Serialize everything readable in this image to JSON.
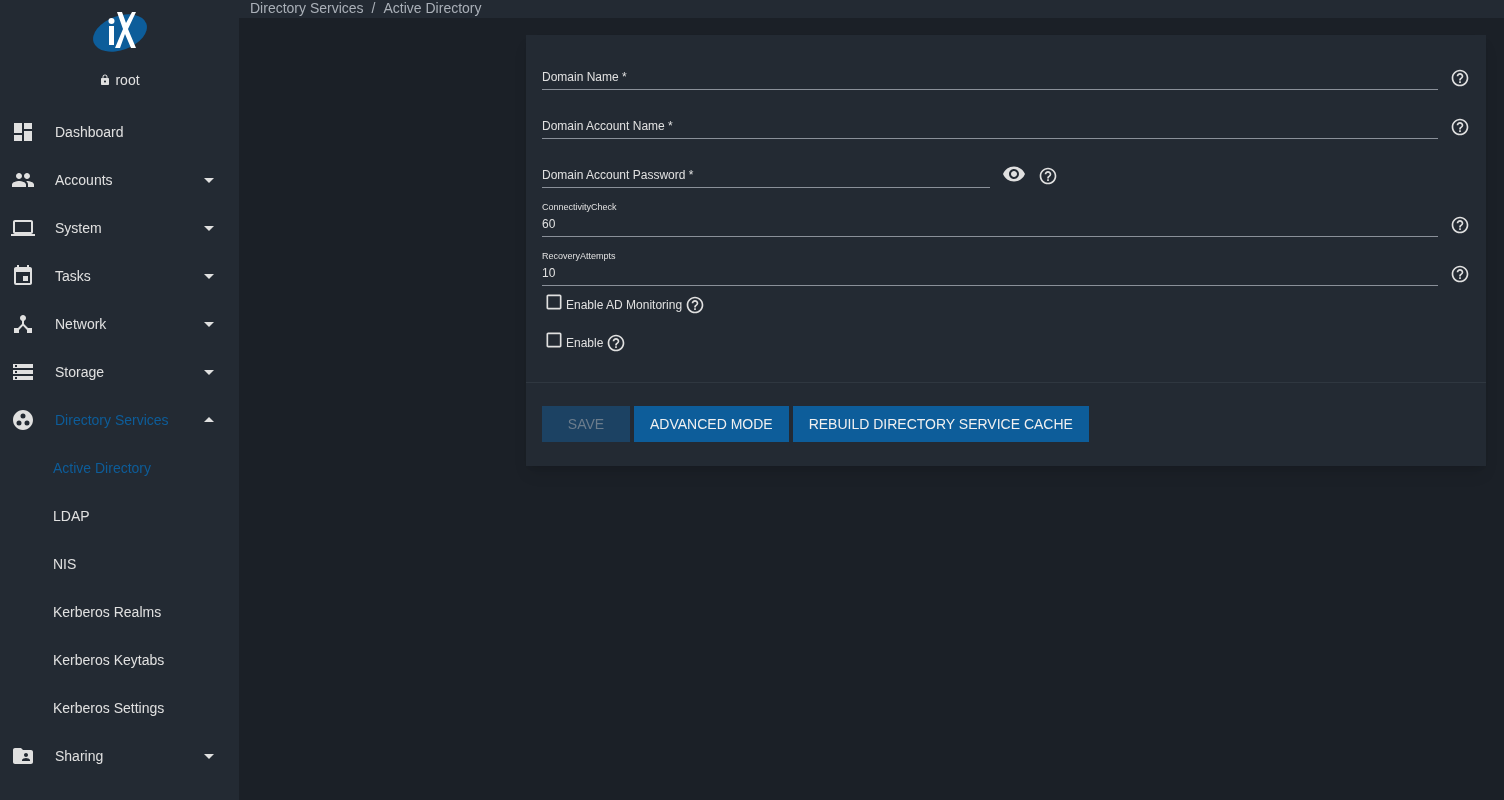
{
  "user": "root",
  "breadcrumb": {
    "items": [
      "Directory Services",
      "Active Directory"
    ],
    "separator": "/"
  },
  "nav": [
    {
      "label": "Dashboard",
      "kind": "link"
    },
    {
      "label": "Accounts",
      "kind": "group",
      "expanded": false
    },
    {
      "label": "System",
      "kind": "group",
      "expanded": false
    },
    {
      "label": "Tasks",
      "kind": "group",
      "expanded": false
    },
    {
      "label": "Network",
      "kind": "group",
      "expanded": false
    },
    {
      "label": "Storage",
      "kind": "group",
      "expanded": false
    },
    {
      "label": "Directory Services",
      "kind": "group",
      "expanded": true,
      "selected": true,
      "children": [
        {
          "label": "Active Directory",
          "selected": true
        },
        {
          "label": "LDAP",
          "selected": false
        },
        {
          "label": "NIS",
          "selected": false
        },
        {
          "label": "Kerberos Realms",
          "selected": false
        },
        {
          "label": "Kerberos Keytabs",
          "selected": false
        },
        {
          "label": "Kerberos Settings",
          "selected": false
        }
      ]
    },
    {
      "label": "Sharing",
      "kind": "group",
      "expanded": false
    }
  ],
  "fields": [
    {
      "kind": "text",
      "label": "Domain Name *"
    },
    {
      "kind": "text",
      "label": "Domain Account Name *"
    },
    {
      "kind": "password",
      "label": "Domain Account Password *"
    },
    {
      "kind": "text",
      "label": "ConnectivityCheck",
      "value": "60"
    },
    {
      "kind": "text",
      "label": "RecoveryAttempts",
      "value": "10"
    },
    {
      "kind": "checkbox",
      "label": "Enable AD Monitoring",
      "checked": false
    },
    {
      "kind": "checkbox",
      "label": "Enable",
      "checked": false
    }
  ],
  "buttons": [
    {
      "label": "SAVE",
      "disabled": true
    },
    {
      "label": "ADVANCED MODE",
      "disabled": false
    },
    {
      "label": "REBUILD DIRECTORY SERVICE CACHE",
      "disabled": false
    }
  ]
}
